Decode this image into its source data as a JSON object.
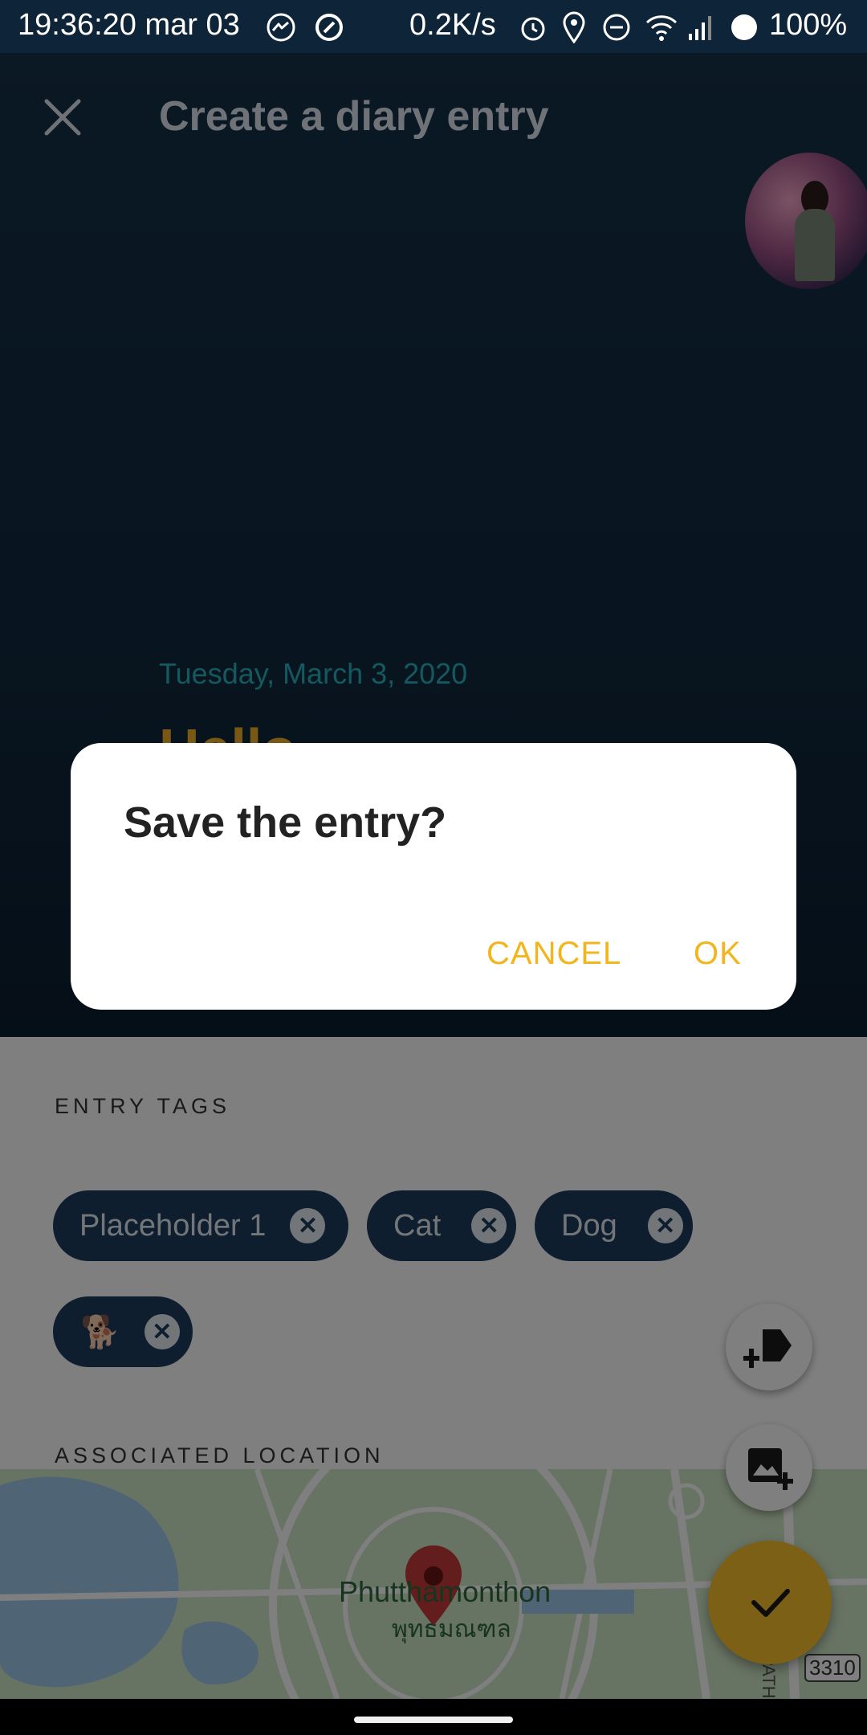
{
  "status_bar": {
    "time": "19:36:20 mar 03",
    "net_speed": "0.2K/s",
    "battery": "100%",
    "icons": [
      "messenger-icon",
      "sync-icon",
      "alarm-icon",
      "location-icon",
      "dnd-icon",
      "wifi-icon",
      "signal-icon",
      "battery-icon"
    ]
  },
  "header": {
    "title": "Create a diary entry",
    "close_icon": "close-icon"
  },
  "entry": {
    "date": "Tuesday, March 3, 2020",
    "title": "Hello"
  },
  "dialog": {
    "title": "Save the entry?",
    "cancel": "CANCEL",
    "ok": "OK"
  },
  "tags": {
    "section_label": "ENTRY TAGS",
    "items": [
      {
        "label": "Placeholder 1"
      },
      {
        "label": "Cat"
      },
      {
        "label": "Dog"
      },
      {
        "label": "🐕"
      }
    ],
    "remove_icon": "remove-tag-icon"
  },
  "location": {
    "section_label": "ASSOCIATED LOCATION",
    "map_label_en": "Phutthamonthon",
    "map_label_th": "พุทธมณฑล",
    "map_label_road": "NAKHON PATHOM",
    "road_number": "3310"
  },
  "colors": {
    "header_bg": "#16324a",
    "chip_bg": "#1d3d5e",
    "accent_yellow": "#f6c02b",
    "date_teal": "#2bb3c0"
  }
}
